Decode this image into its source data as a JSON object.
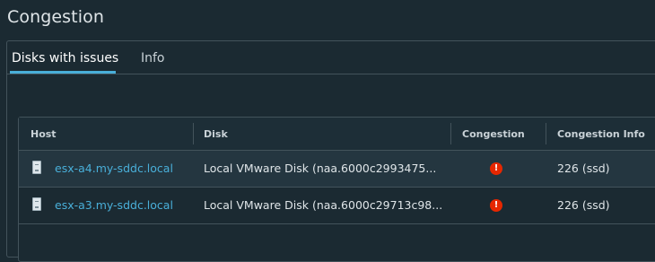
{
  "page": {
    "title": "Congestion"
  },
  "tabs": [
    {
      "label": "Disks with issues",
      "active": true
    },
    {
      "label": "Info",
      "active": false
    }
  ],
  "table": {
    "columns": [
      "Host",
      "Disk",
      "Congestion",
      "Congestion Info"
    ],
    "rows": [
      {
        "host": "esx-a4.my-sddc.local",
        "disk": "Local VMware Disk (naa.6000c2993475...",
        "congestion_icon": "error-icon",
        "congestion_info": "226 (ssd)"
      },
      {
        "host": "esx-a3.my-sddc.local",
        "disk": "Local VMware Disk (naa.6000c29713c98...",
        "congestion_icon": "error-icon",
        "congestion_info": "226 (ssd)"
      }
    ]
  },
  "colors": {
    "background": "#1b2a32",
    "accent": "#49afd9",
    "error": "#e62700",
    "border": "#43535b"
  }
}
